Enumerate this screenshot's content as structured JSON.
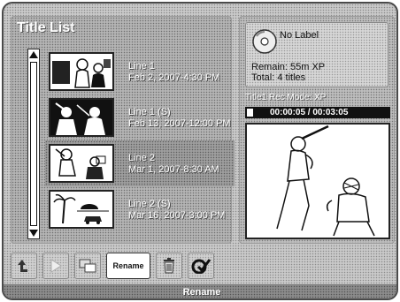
{
  "list": {
    "title": "Title List",
    "items": [
      {
        "name": "Line 1",
        "date": "Feb 2, 2007-4:30 PM"
      },
      {
        "name": "Line 1 (S)",
        "date": "Feb 13, 2007-12:00 PM"
      },
      {
        "name": "Line 2",
        "date": "Mar 1, 2007-8:30 AM"
      },
      {
        "name": "Line 2 (S)",
        "date": "Mar 16, 2007-3:00 PM"
      }
    ]
  },
  "info": {
    "disc_label": "No Label",
    "remain": "Remain: 55m  XP",
    "total": "Total: 4 titles",
    "rec_mode": "Title1 Rec Mode: XP",
    "time": "00:00:05  /  00:03:05"
  },
  "toolbar": {
    "rename_label": "Rename"
  },
  "status": {
    "text": "Rename"
  }
}
